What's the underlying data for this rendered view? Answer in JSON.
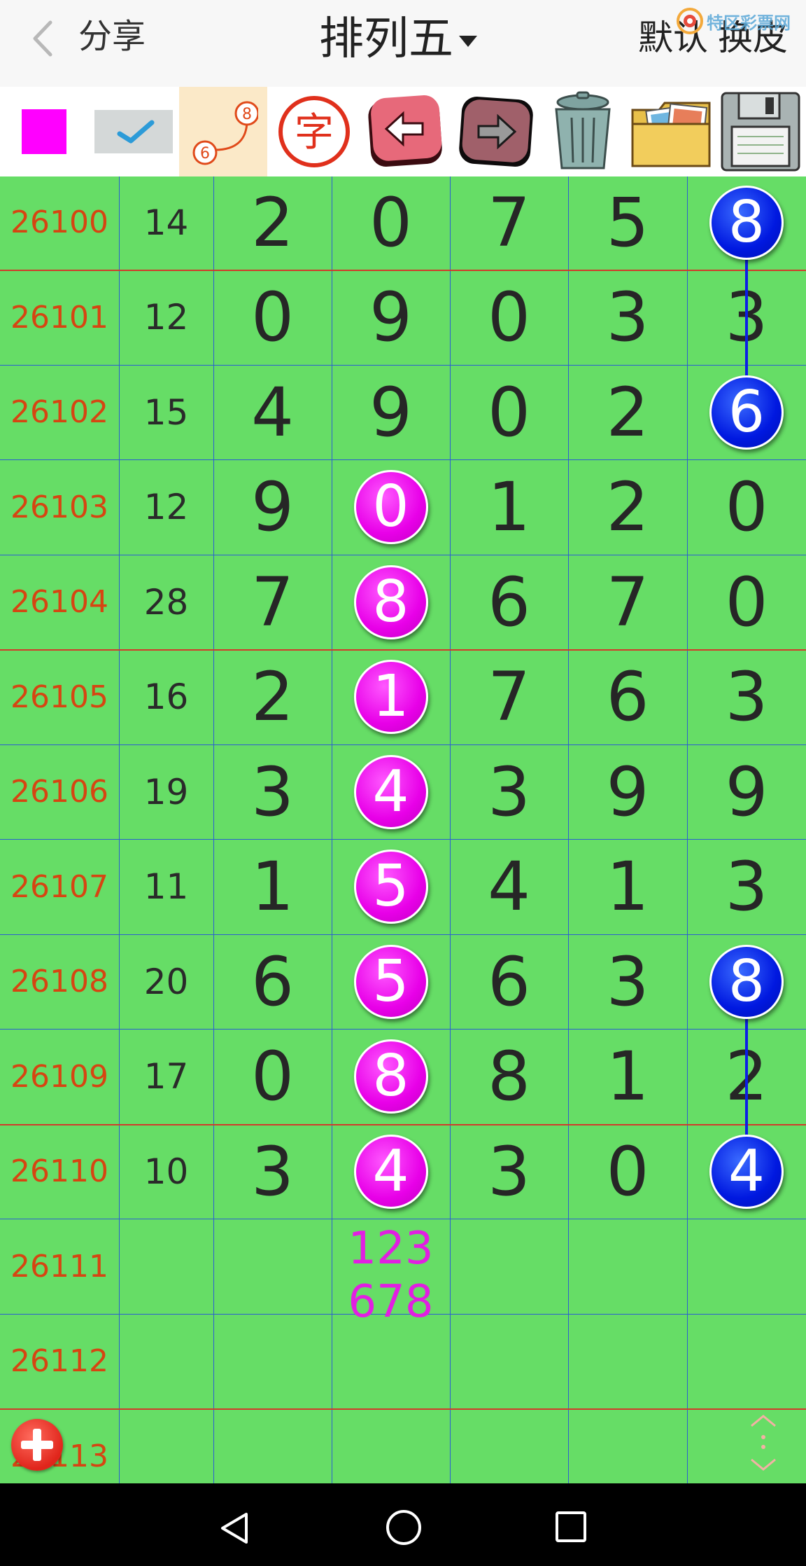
{
  "header": {
    "back_label": "",
    "share_label": "分享",
    "title": "排列五",
    "default_label": "默认",
    "skin_label": "换皮",
    "watermark": "特区彩票网"
  },
  "toolbar": {
    "items": [
      {
        "name": "color-swatch",
        "icon": "magenta-square"
      },
      {
        "name": "confirm",
        "icon": "check-icon"
      },
      {
        "name": "connect-line",
        "icon": "connect-line-icon",
        "label_a": "8",
        "label_b": "6"
      },
      {
        "name": "text-tool",
        "icon": "char-icon",
        "label": "字"
      },
      {
        "name": "undo",
        "icon": "arrow-left-icon"
      },
      {
        "name": "redo",
        "icon": "arrow-right-icon"
      },
      {
        "name": "clear",
        "icon": "trash-icon"
      },
      {
        "name": "gallery",
        "icon": "photo-folder-icon"
      },
      {
        "name": "save",
        "icon": "floppy-disk-icon"
      }
    ],
    "active_index": 2,
    "swatch_color": "#ff00ff"
  },
  "colors": {
    "grid_bg": "#66dd66",
    "issue_text": "#d64512",
    "magenta_ball": "#e800e8",
    "blue_ball": "#0018e0",
    "prediction_text": "#e21ee2",
    "divider_red": "#d23a2a",
    "divider_blue": "#2b5fd1"
  },
  "rows": [
    {
      "issue": "26100",
      "sum": "14",
      "digits": [
        "2",
        "0",
        "7",
        "5",
        "8"
      ],
      "marks": {
        "4": "blue"
      }
    },
    {
      "issue": "26101",
      "sum": "12",
      "digits": [
        "0",
        "9",
        "0",
        "3",
        "3"
      ],
      "marks": {}
    },
    {
      "issue": "26102",
      "sum": "15",
      "digits": [
        "4",
        "9",
        "0",
        "2",
        "6"
      ],
      "marks": {
        "4": "blue"
      }
    },
    {
      "issue": "26103",
      "sum": "12",
      "digits": [
        "9",
        "0",
        "1",
        "2",
        "0"
      ],
      "marks": {
        "1": "magenta"
      }
    },
    {
      "issue": "26104",
      "sum": "28",
      "digits": [
        "7",
        "8",
        "6",
        "7",
        "0"
      ],
      "marks": {
        "1": "magenta"
      }
    },
    {
      "issue": "26105",
      "sum": "16",
      "digits": [
        "2",
        "1",
        "7",
        "6",
        "3"
      ],
      "marks": {
        "1": "magenta"
      }
    },
    {
      "issue": "26106",
      "sum": "19",
      "digits": [
        "3",
        "4",
        "3",
        "9",
        "9"
      ],
      "marks": {
        "1": "magenta"
      }
    },
    {
      "issue": "26107",
      "sum": "11",
      "digits": [
        "1",
        "5",
        "4",
        "1",
        "3"
      ],
      "marks": {
        "1": "magenta"
      }
    },
    {
      "issue": "26108",
      "sum": "20",
      "digits": [
        "6",
        "5",
        "6",
        "3",
        "8"
      ],
      "marks": {
        "1": "magenta",
        "4": "blue"
      }
    },
    {
      "issue": "26109",
      "sum": "17",
      "digits": [
        "0",
        "8",
        "8",
        "1",
        "2"
      ],
      "marks": {
        "1": "magenta"
      }
    },
    {
      "issue": "26110",
      "sum": "10",
      "digits": [
        "3",
        "4",
        "3",
        "0",
        "4"
      ],
      "marks": {
        "1": "magenta",
        "4": "blue"
      }
    },
    {
      "issue": "26111",
      "sum": "",
      "digits": [
        "",
        "",
        "",
        "",
        ""
      ],
      "marks": {},
      "prediction": {
        "column": 1,
        "lines": [
          "123",
          "678"
        ]
      }
    },
    {
      "issue": "26112",
      "sum": "",
      "digits": [
        "",
        "",
        "",
        "",
        ""
      ],
      "marks": {}
    },
    {
      "issue": "26113",
      "sum": "",
      "digits": [
        "",
        "",
        "",
        "",
        ""
      ],
      "marks": {}
    }
  ],
  "red_divider_after_rows": [
    0,
    4,
    9,
    12
  ],
  "connectors": [
    {
      "column": 4,
      "from_row": 0,
      "to_row": 2
    },
    {
      "column": 4,
      "from_row": 8,
      "to_row": 10
    }
  ],
  "floating": {
    "add_button_icon": "plus-icon",
    "scroll_icon": "scroll-up-down-icon"
  },
  "navbar": {
    "buttons": [
      "back-triangle-icon",
      "home-circle-icon",
      "recents-square-icon"
    ]
  }
}
